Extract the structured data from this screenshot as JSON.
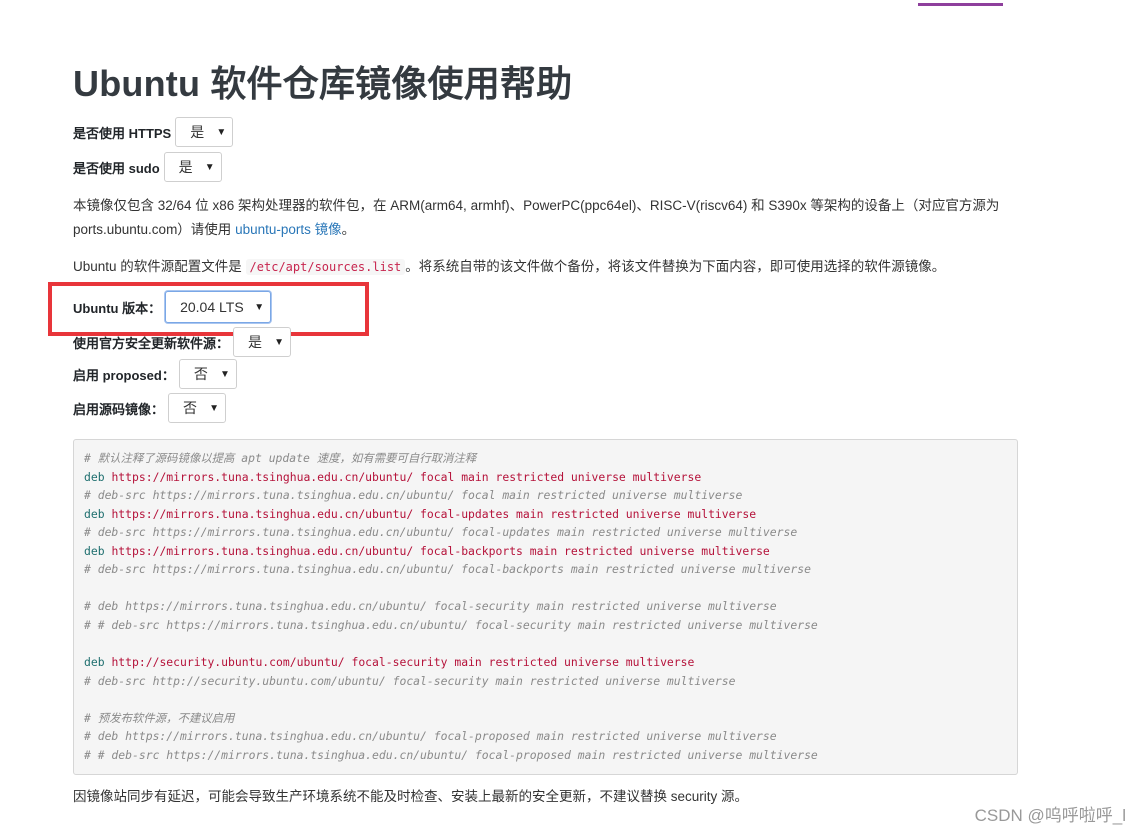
{
  "title": "Ubuntu 软件仓库镜像使用帮助",
  "options": {
    "https": {
      "label": "是否使用 HTTPS",
      "value": "是"
    },
    "sudo": {
      "label": "是否使用 sudo",
      "value": "是"
    },
    "version": {
      "label": "Ubuntu 版本：",
      "value": "20.04 LTS"
    },
    "security": {
      "label": "使用官方安全更新软件源：",
      "value": "是"
    },
    "proposed": {
      "label": "启用 proposed：",
      "value": "否"
    },
    "source": {
      "label": "启用源码镜像：",
      "value": "否"
    }
  },
  "intro": {
    "text": "本镜像仅包含 32/64 位 x86 架构处理器的软件包，在 ARM(arm64, armhf)、PowerPC(ppc64el)、RISC-V(riscv64) 和 S390x 等架构的设备上（对应官方源为 ports.ubuntu.com）请使用 ",
    "link": "ubuntu-ports 镜像",
    "end": "。"
  },
  "config": {
    "before": "Ubuntu 的软件源配置文件是 ",
    "path": "/etc/apt/sources.list",
    "after": "。将系统自带的该文件做个备份，将该文件替换为下面内容，即可使用选择的软件源镜像。"
  },
  "code_lines": [
    {
      "type": "comment",
      "text": "# 默认注释了源码镜像以提高 apt update 速度，如有需要可自行取消注释"
    },
    {
      "type": "deb",
      "kw": "deb",
      "url": "https://mirrors.tuna.tsinghua.edu.cn/ubuntu/",
      "suite": "focal main restricted universe multiverse"
    },
    {
      "type": "comment",
      "text": "# deb-src https://mirrors.tuna.tsinghua.edu.cn/ubuntu/ focal main restricted universe multiverse"
    },
    {
      "type": "deb",
      "kw": "deb",
      "url": "https://mirrors.tuna.tsinghua.edu.cn/ubuntu/",
      "suite": "focal-updates main restricted universe multiverse"
    },
    {
      "type": "comment",
      "text": "# deb-src https://mirrors.tuna.tsinghua.edu.cn/ubuntu/ focal-updates main restricted universe multiverse"
    },
    {
      "type": "deb",
      "kw": "deb",
      "url": "https://mirrors.tuna.tsinghua.edu.cn/ubuntu/",
      "suite": "focal-backports main restricted universe multiverse"
    },
    {
      "type": "comment",
      "text": "# deb-src https://mirrors.tuna.tsinghua.edu.cn/ubuntu/ focal-backports main restricted universe multiverse"
    },
    {
      "type": "blank",
      "text": ""
    },
    {
      "type": "comment",
      "text": "# deb https://mirrors.tuna.tsinghua.edu.cn/ubuntu/ focal-security main restricted universe multiverse"
    },
    {
      "type": "comment",
      "text": "# # deb-src https://mirrors.tuna.tsinghua.edu.cn/ubuntu/ focal-security main restricted universe multiverse"
    },
    {
      "type": "blank",
      "text": ""
    },
    {
      "type": "deb",
      "kw": "deb",
      "url": "http://security.ubuntu.com/ubuntu/",
      "suite": "focal-security main restricted universe multiverse"
    },
    {
      "type": "comment",
      "text": "# deb-src http://security.ubuntu.com/ubuntu/ focal-security main restricted universe multiverse"
    },
    {
      "type": "blank",
      "text": ""
    },
    {
      "type": "comment",
      "text": "# 预发布软件源，不建议启用"
    },
    {
      "type": "comment",
      "text": "# deb https://mirrors.tuna.tsinghua.edu.cn/ubuntu/ focal-proposed main restricted universe multiverse"
    },
    {
      "type": "comment",
      "text": "# # deb-src https://mirrors.tuna.tsinghua.edu.cn/ubuntu/ focal-proposed main restricted universe multiverse"
    }
  ],
  "footer_note": "因镜像站同步有延迟，可能会导致生产环境系统不能及时检查、安装上最新的安全更新，不建议替换 security 源。",
  "watermark": "CSDN @呜呼啦呼_l",
  "colors": {
    "highlight": "#e8353a",
    "accent": "#8e3f9c",
    "link": "#2a77b8"
  }
}
